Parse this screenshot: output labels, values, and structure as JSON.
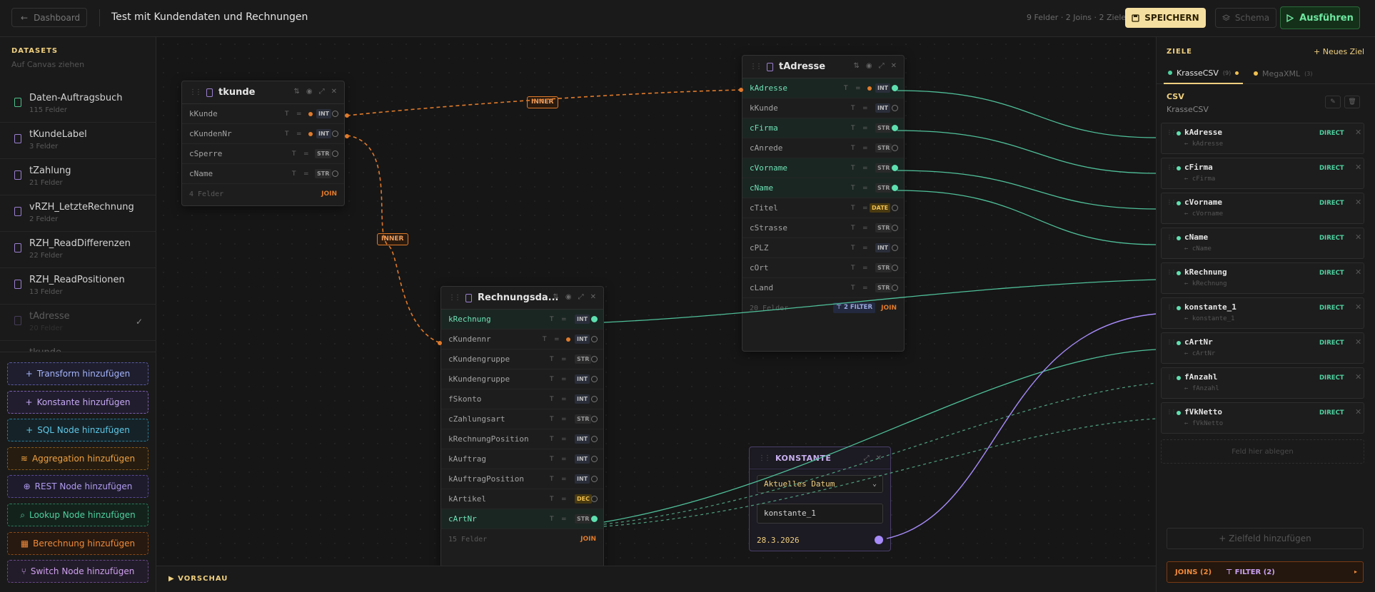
{
  "topbar": {
    "back_label": "Dashboard",
    "title": "Test mit Kundendaten und Rechnungen",
    "stats": "9 Felder · 2 Joins · 2 Ziele",
    "save_label": "SPEICHERN",
    "schema_label": "Schema",
    "run_label": "Ausführen"
  },
  "sidebar": {
    "title": "DATASETS",
    "subtitle": "Auf Canvas ziehen",
    "items": [
      {
        "name": "Daten-Auftragsbuch",
        "count": "115 Felder"
      },
      {
        "name": "tKundeLabel",
        "count": "3 Felder"
      },
      {
        "name": "tZahlung",
        "count": "21 Felder"
      },
      {
        "name": "vRZH_LetzteRechnung",
        "count": "2 Felder"
      },
      {
        "name": "RZH_ReadDifferenzen",
        "count": "22 Felder"
      },
      {
        "name": "RZH_ReadPositionen",
        "count": "13 Felder"
      },
      {
        "name": "tAdresse",
        "count": "20 Felder"
      },
      {
        "name": "tkunde",
        "count": ""
      }
    ],
    "add_buttons": [
      {
        "label": "Transform hinzufügen",
        "color": "#a5b4fc"
      },
      {
        "label": "Konstante hinzufügen",
        "color": "#c4a8f5"
      },
      {
        "label": "SQL Node hinzufügen",
        "color": "#5fc8e8"
      },
      {
        "label": "Aggregation hinzufügen",
        "color": "#f0a040"
      },
      {
        "label": "REST Node hinzufügen",
        "color": "#b09cf0"
      },
      {
        "label": "Lookup Node hinzufügen",
        "color": "#4fd0a0"
      },
      {
        "label": "Berechnung hinzufügen",
        "color": "#f08a3a"
      },
      {
        "label": "Switch Node hinzufügen",
        "color": "#d0a0f0"
      }
    ]
  },
  "nodes": {
    "tkunde": {
      "title": "tkunde",
      "fields": [
        {
          "name": "kKunde",
          "type": "INT"
        },
        {
          "name": "cKundenNr",
          "type": "INT"
        },
        {
          "name": "cSperre",
          "type": "STR"
        },
        {
          "name": "cName",
          "type": "STR"
        }
      ],
      "footer": "4 Felder",
      "join": "JOIN"
    },
    "tadresse": {
      "title": "tAdresse",
      "fields": [
        {
          "name": "kAdresse",
          "type": "INT"
        },
        {
          "name": "kKunde",
          "type": "INT"
        },
        {
          "name": "cFirma",
          "type": "STR"
        },
        {
          "name": "cAnrede",
          "type": "STR"
        },
        {
          "name": "cVorname",
          "type": "STR"
        },
        {
          "name": "cName",
          "type": "STR"
        },
        {
          "name": "cTitel",
          "type": "DATE"
        },
        {
          "name": "cStrasse",
          "type": "STR"
        },
        {
          "name": "cPLZ",
          "type": "INT"
        },
        {
          "name": "cOrt",
          "type": "STR"
        },
        {
          "name": "cLand",
          "type": "STR"
        }
      ],
      "footer": "20 Felder",
      "filter": "⊤ 2  FILTER",
      "join": "JOIN"
    },
    "rechnung": {
      "title": "Rechnungsda...",
      "fields": [
        {
          "name": "kRechnung",
          "type": "INT"
        },
        {
          "name": "cKundennr",
          "type": "INT"
        },
        {
          "name": "cKundengruppe",
          "type": "STR"
        },
        {
          "name": "kKundengruppe",
          "type": "INT"
        },
        {
          "name": "fSkonto",
          "type": "INT"
        },
        {
          "name": "cZahlungsart",
          "type": "STR"
        },
        {
          "name": "kRechnungPosition",
          "type": "INT"
        },
        {
          "name": "kAuftrag",
          "type": "INT"
        },
        {
          "name": "kAuftragPosition",
          "type": "INT"
        },
        {
          "name": "kArtikel",
          "type": "DEC"
        },
        {
          "name": "cArtNr",
          "type": "STR"
        }
      ],
      "footer": "15 Felder",
      "join": "JOIN"
    },
    "konstante": {
      "title": "KONSTANTE",
      "select_value": "Aktuelles Datum",
      "name_value": "konstante_1",
      "output_value": "28.3.2026"
    }
  },
  "joins": [
    "INNER",
    "INNER"
  ],
  "preview_label": "▶ VORSCHAU",
  "right": {
    "title": "ZIELE",
    "new_target": "+  Neues Ziel",
    "tabs": [
      {
        "label": "KrasseCSV",
        "count": "(9)"
      },
      {
        "label": "MegaXML",
        "count": "(3)"
      }
    ],
    "type_label": "CSV",
    "target_name": "KrasseCSV",
    "fields": [
      {
        "name": "kAdresse",
        "src": "← kAdresse"
      },
      {
        "name": "cFirma",
        "src": "← cFirma"
      },
      {
        "name": "cVorname",
        "src": "← cVorname"
      },
      {
        "name": "cName",
        "src": "← cName"
      },
      {
        "name": "kRechnung",
        "src": "← kRechnung"
      },
      {
        "name": "konstante_1",
        "src": "← konstante_1"
      },
      {
        "name": "cArtNr",
        "src": "← cArtNr"
      },
      {
        "name": "fAnzahl",
        "src": "← fAnzahl"
      },
      {
        "name": "fVkNetto",
        "src": "← fVkNetto"
      }
    ],
    "mapping_label": "DIRECT",
    "drop_label": "Feld hier ablegen",
    "add_field": "+ Zielfeld hinzufügen",
    "joins_label": "JOINS (2)",
    "filter_label": "⊤ FILTER (2)"
  }
}
